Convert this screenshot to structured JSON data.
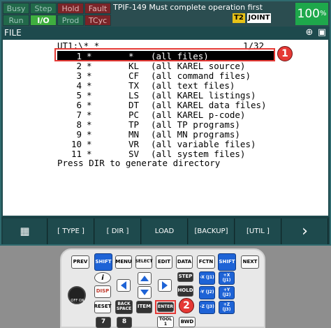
{
  "status": {
    "indicators": [
      {
        "label": "Busy",
        "state": "off"
      },
      {
        "label": "Step",
        "state": "off"
      },
      {
        "label": "Hold",
        "state": "red"
      },
      {
        "label": "Fault",
        "state": "red"
      },
      {
        "label": "Run",
        "state": "off"
      },
      {
        "label": "I/O",
        "state": "on"
      },
      {
        "label": "Prod",
        "state": "off"
      },
      {
        "label": "TCyc",
        "state": "red"
      }
    ],
    "message": "TPIF-149 Must complete operation first",
    "mode_badge": "T2",
    "coord_badge": "JOINT",
    "override": "100",
    "override_unit": "%"
  },
  "screen": {
    "title": "FILE",
    "path": "UT1:\\* *",
    "page": "1/32",
    "files": [
      {
        "num": "1",
        "name": "*",
        "ext": "*",
        "desc": "(all files)",
        "selected": true
      },
      {
        "num": "2",
        "name": "*",
        "ext": "KL",
        "desc": "(all KAREL source)"
      },
      {
        "num": "3",
        "name": "*",
        "ext": "CF",
        "desc": "(all command files)"
      },
      {
        "num": "4",
        "name": "*",
        "ext": "TX",
        "desc": "(all text files)"
      },
      {
        "num": "5",
        "name": "*",
        "ext": "LS",
        "desc": "(all KAREL listings)"
      },
      {
        "num": "6",
        "name": "*",
        "ext": "DT",
        "desc": "(all KAREL data files)"
      },
      {
        "num": "7",
        "name": "*",
        "ext": "PC",
        "desc": "(all KAREL p-code)"
      },
      {
        "num": "8",
        "name": "*",
        "ext": "TP",
        "desc": "(all TP programs)"
      },
      {
        "num": "9",
        "name": "*",
        "ext": "MN",
        "desc": "(all MN programs)"
      },
      {
        "num": "10",
        "name": "*",
        "ext": "VR",
        "desc": "(all variable files)"
      },
      {
        "num": "11",
        "name": "*",
        "ext": "SV",
        "desc": "(all system files)"
      }
    ],
    "hint": "Press DIR to generate directory",
    "function_keys": [
      "[ TYPE ]",
      "[ DIR ]",
      "LOAD",
      "[BACKUP]",
      "[UTIL ]"
    ]
  },
  "annotations": {
    "badge1": "1",
    "badge2": "2"
  },
  "keypad": {
    "row1": [
      "PREV",
      "SHIFT",
      "MENU",
      "SELECT",
      "EDIT",
      "DATA",
      "FCTN",
      "SHIFT",
      "NEXT"
    ],
    "info_icon": "i",
    "disp_label": "DISP",
    "step": "STEP",
    "hold": "HOLD",
    "reset": "RESET",
    "backspace": "BACK SPACE",
    "item": "ITEM",
    "enter": "ENTER",
    "tool1": "TOOL 1",
    "bwd": "BWD",
    "key_7": "7",
    "key_8": "8",
    "jog": [
      "-X (J1)",
      "+X (J1)",
      "-Y (J2)",
      "+Y (J2)",
      "-Z (J3)",
      "+Z (J3)"
    ],
    "estop_label": "OFF ON"
  },
  "colors": {
    "accent_red": "#e53935",
    "status_green": "#1ea84b",
    "shift_blue": "#1e63d6"
  }
}
